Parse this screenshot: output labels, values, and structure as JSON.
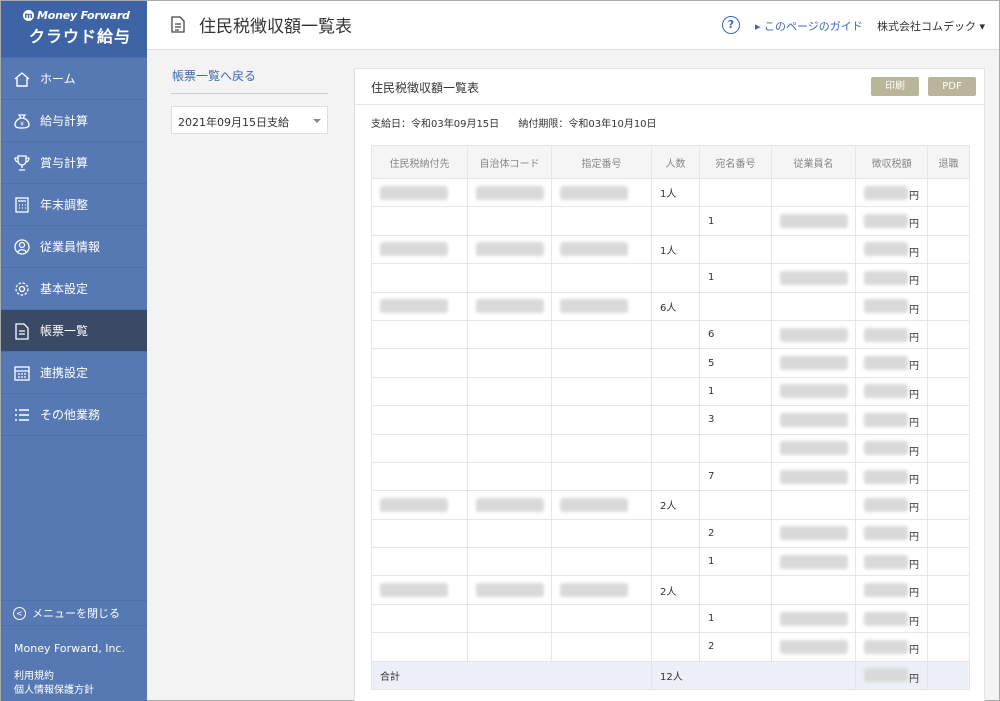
{
  "app": {
    "brand": "Money Forward",
    "product": "クラウド給与"
  },
  "sidebar": {
    "items": [
      {
        "label": "ホーム",
        "icon": "home-icon"
      },
      {
        "label": "給与計算",
        "icon": "money-bag-icon"
      },
      {
        "label": "賞与計算",
        "icon": "trophy-icon"
      },
      {
        "label": "年末調整",
        "icon": "calculator-icon"
      },
      {
        "label": "従業員情報",
        "icon": "person-icon"
      },
      {
        "label": "基本設定",
        "icon": "gear-icon"
      },
      {
        "label": "帳票一覧",
        "icon": "document-icon"
      },
      {
        "label": "連携設定",
        "icon": "calendar-icon"
      },
      {
        "label": "その他業務",
        "icon": "list-icon"
      }
    ],
    "active_index": 6,
    "close_menu": "メニューを閉じる",
    "company": "Money Forward, Inc.",
    "terms": "利用規約",
    "privacy": "個人情報保護方針"
  },
  "header": {
    "title": "住民税徴収額一覧表",
    "help": "?",
    "guide": "このページのガイド",
    "company": "株式会社コムデック"
  },
  "left": {
    "back_link": "帳票一覧へ戻る",
    "period_select": "2021年09月15日支給"
  },
  "panel": {
    "title": "住民税徴収額一覧表",
    "print_label": "印刷",
    "pdf_label": "PDF",
    "pay_date": "支給日：令和03年09月15日",
    "deadline": "納付期限：令和03年10月10日"
  },
  "table": {
    "headers": [
      "住民税納付先",
      "自治体コード",
      "指定番号",
      "人数",
      "宛名番号",
      "従業員名",
      "徴収税額",
      "退職"
    ],
    "yen": "円",
    "rows": [
      {
        "group": true,
        "count": "1人",
        "addr": ""
      },
      {
        "group": false,
        "count": "",
        "addr": "1"
      },
      {
        "group": true,
        "count": "1人",
        "addr": ""
      },
      {
        "group": false,
        "count": "",
        "addr": "1"
      },
      {
        "group": true,
        "count": "6人",
        "addr": ""
      },
      {
        "group": false,
        "count": "",
        "addr": "6"
      },
      {
        "group": false,
        "count": "",
        "addr": "5"
      },
      {
        "group": false,
        "count": "",
        "addr": "1"
      },
      {
        "group": false,
        "count": "",
        "addr": "3"
      },
      {
        "group": false,
        "count": "",
        "addr": ""
      },
      {
        "group": false,
        "count": "",
        "addr": "7"
      },
      {
        "group": true,
        "count": "2人",
        "addr": ""
      },
      {
        "group": false,
        "count": "",
        "addr": "2"
      },
      {
        "group": false,
        "count": "",
        "addr": "1"
      },
      {
        "group": true,
        "count": "2人",
        "addr": ""
      },
      {
        "group": false,
        "count": "",
        "addr": "1"
      },
      {
        "group": false,
        "count": "",
        "addr": "2"
      }
    ],
    "total_label": "合計",
    "total_count": "12人"
  }
}
